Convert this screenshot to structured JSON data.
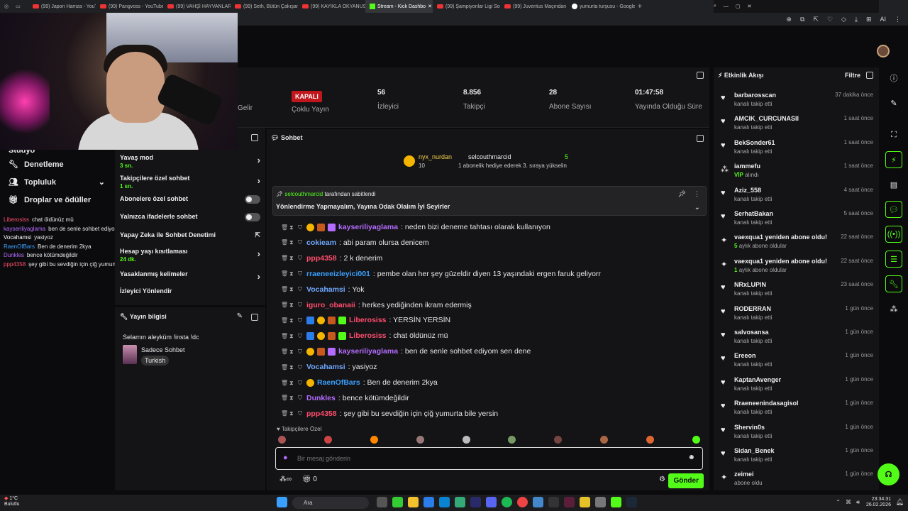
{
  "browser": {
    "tabs": [
      {
        "label": "(99) Japon Hamza - YouTu",
        "icon": "youtube-icon"
      },
      {
        "label": "(99) Pangvoss - YouTube",
        "icon": "youtube-icon"
      },
      {
        "label": "(99) VAHŞİ HAYVANLARI...",
        "icon": "youtube-icon"
      },
      {
        "label": "(99) Seth, Bütün Çakışanla",
        "icon": "youtube-icon"
      },
      {
        "label": "(99) KAYIKLA OKYANUSU",
        "icon": "youtube-icon"
      },
      {
        "label": "Stream - Kick Dashbo",
        "icon": "kick-icon",
        "active": true
      },
      {
        "label": "(99) Şampiyonlar Ligi Son",
        "icon": "youtube-icon"
      },
      {
        "label": "(99) Juventus Maçından Ç",
        "icon": "youtube-icon"
      },
      {
        "label": "yumurta turşusu - Google",
        "icon": "google-icon"
      }
    ],
    "ai_label": "AI"
  },
  "stats": {
    "items": [
      {
        "value": "",
        "label": "Gelir"
      },
      {
        "value": "KAPALI",
        "label": "Çoklu Yayın"
      },
      {
        "value": "56",
        "label": "İzleyici"
      },
      {
        "value": "8.856",
        "label": "Takipçi"
      },
      {
        "value": "28",
        "label": "Abone Sayısı"
      },
      {
        "value": "01:47:58",
        "label": "Yayında Olduğu Süre"
      }
    ]
  },
  "left_nav": {
    "items": [
      {
        "label": "Stüdyo"
      },
      {
        "label": "Denetleme"
      },
      {
        "label": "Topluluk"
      },
      {
        "label": "Droplar ve ödüller"
      }
    ]
  },
  "mini_chat": [
    {
      "user": "Liberosiss",
      "text": "chat öldünüz mü",
      "color": "#ff4d6d"
    },
    {
      "user": "kayseriliyaglama",
      "text": "ben de senle sohbet ediyom sen dene",
      "color": "#b46cff"
    },
    {
      "user": "Vocahamsi",
      "text": "yasiyoz",
      "color": "#ffffff"
    },
    {
      "user": "RaenOfBars",
      "text": "Ben de denerim 2kya",
      "color": "#3aa0ff"
    },
    {
      "user": "Dunkles",
      "text": "bence kötümdeğildir",
      "color": "#b46cff"
    },
    {
      "user": "ppp4358",
      "text": "şey gibi bu sevdiğin için çiğ yumurta bile yersin",
      "color": "#ff4d6d"
    }
  ],
  "mod_settings": {
    "items": [
      {
        "label": "Yavaş mod",
        "sub": "3 sn.",
        "control": "chevron"
      },
      {
        "label": "Takipçilere özel sohbet",
        "sub": "1 sn.",
        "control": "chevron"
      },
      {
        "label": "Abonelere özel sohbet",
        "sub": "",
        "control": "toggle"
      },
      {
        "label": "Yalnızca ifadelerle sohbet",
        "sub": "",
        "control": "toggle"
      },
      {
        "label": "Yapay Zeka ile Sohbet Denetimi",
        "sub": "",
        "control": "external"
      },
      {
        "label": "Hesap yaşı kısıtlaması",
        "sub": "24 dk.",
        "control": "chevron"
      },
      {
        "label": "Yasaklanmış kelimeler",
        "sub": "",
        "control": "chevron"
      },
      {
        "label": "İzleyici Yönlendir",
        "sub": "",
        "control": "none"
      }
    ]
  },
  "stream_info": {
    "title": "Yayın bilgisi",
    "stream_title": "Selamın aleyküm !insta !dc",
    "category": "Sadece Sohbet",
    "language": "Turkish"
  },
  "chat": {
    "title": "Sohbet",
    "gift_event": {
      "gifter": "nyx_nurdan",
      "gifter_count": "10",
      "recipient": "selcouthmarcid",
      "recipient_count": "5",
      "text": "1 abonelik hediye ederek 3. sıraya yükselin"
    },
    "pinned": {
      "by_user": "selcouthmarcid",
      "by_text": "tarafından sabitlendi",
      "message": "Yönlendirme Yapmayalım, Yayına Odak Olalım İyi Seyirler"
    },
    "messages": [
      {
        "user": "kayseriliyaglama",
        "color": "#b46cff",
        "text": ": neden bizi deneme tahtası olarak kullanıyon",
        "badges": [
          "gold",
          "red",
          "purple"
        ]
      },
      {
        "user": "cokieam",
        "color": "#6fa8ff",
        "text": ": abi param olursa denicem",
        "badges": []
      },
      {
        "user": "ppp4358",
        "color": "#ff4d6d",
        "text": ": 2 k denerim",
        "badges": []
      },
      {
        "user": "rraeneeizleyici001",
        "color": "#3aa0ff",
        "text": ": pembe olan her şey güzeldir diyen 13 yaşındaki ergen faruk geliyorr",
        "badges": []
      },
      {
        "user": "Vocahamsi",
        "color": "#6fa8ff",
        "text": ": Yok",
        "badges": []
      },
      {
        "user": "iguro_obanaii",
        "color": "#ff4d6d",
        "text": ": herkes yediğinden ikram edermiş",
        "badges": []
      },
      {
        "user": "Liberosiss",
        "color": "#ff4d6d",
        "text": ": YERSİN YERSİN",
        "badges": [
          "blue",
          "gold",
          "red",
          "green"
        ]
      },
      {
        "user": "Liberosiss",
        "color": "#ff4d6d",
        "text": ": chat öldünüz mü",
        "badges": [
          "blue",
          "gold",
          "red",
          "green"
        ]
      },
      {
        "user": "kayseriliyaglama",
        "color": "#b46cff",
        "text": ": ben de senle sohbet ediyom sen dene",
        "badges": [
          "gold",
          "red",
          "purple"
        ]
      },
      {
        "user": "Vocahamsi",
        "color": "#6fa8ff",
        "text": ": yasiyoz",
        "badges": []
      },
      {
        "user": "RaenOfBars",
        "color": "#3aa0ff",
        "text": ": Ben de denerim 2kya",
        "badges": [
          "gold"
        ]
      },
      {
        "user": "Dunkles",
        "color": "#b46cff",
        "text": ": bence kötümdeğildir",
        "badges": []
      },
      {
        "user": "ppp4358",
        "color": "#ff4d6d",
        "text": ": şey gibi bu sevdiğin için çiğ yumurta bile yersin",
        "badges": []
      }
    ],
    "followers_label": "Takipçilere Özel",
    "input_placeholder": "Bir mesaj gönderin",
    "points_value": "0",
    "send_label": "Gönder"
  },
  "activity": {
    "title": "Etkinlik Akışı",
    "filter_label": "Filtre",
    "events": [
      {
        "name": "barbarosscan",
        "desc": "kanalı takip etti",
        "time": "37 dakika önce",
        "icon": "heart-icon"
      },
      {
        "name": "AMCIK_CURCUNASII",
        "desc": "kanalı takip etti",
        "time": "1 saat önce",
        "icon": "heart-icon"
      },
      {
        "name": "BekSonder61",
        "desc": "kanalı takip etti",
        "time": "1 saat önce",
        "icon": "heart-icon"
      },
      {
        "name": "iammefu",
        "desc": "alındı",
        "highlight": "VİP",
        "time": "1 saat önce",
        "icon": "vip-icon"
      },
      {
        "name": "Aziz_558",
        "desc": "kanalı takip etti",
        "time": "4 saat önce",
        "icon": "heart-icon"
      },
      {
        "name": "SerhatBakan",
        "desc": "kanalı takip etti",
        "time": "5 saat önce",
        "icon": "heart-icon"
      },
      {
        "name": "vaexqua1 yeniden abone oldu!",
        "desc": "aylık abone oldular",
        "highlight": "5",
        "time": "22 saat önce",
        "icon": "sparkle-icon"
      },
      {
        "name": "vaexqua1 yeniden abone oldu!",
        "desc": "aylık abone oldular",
        "highlight": "1",
        "time": "22 saat önce",
        "icon": "sparkle-icon"
      },
      {
        "name": "NRxLUPIN",
        "desc": "kanalı takip etti",
        "time": "23 saat önce",
        "icon": "heart-icon"
      },
      {
        "name": "RODERRAN",
        "desc": "kanalı takip etti",
        "time": "1 gün önce",
        "icon": "heart-icon"
      },
      {
        "name": "salvosansa",
        "desc": "kanalı takip etti",
        "time": "1 gün önce",
        "icon": "heart-icon"
      },
      {
        "name": "Ereeon",
        "desc": "kanalı takip etti",
        "time": "1 gün önce",
        "icon": "heart-icon"
      },
      {
        "name": "KaptanAvenger",
        "desc": "kanalı takip etti",
        "time": "1 gün önce",
        "icon": "heart-icon"
      },
      {
        "name": "Rraeneenindasagisol",
        "desc": "kanalı takip etti",
        "time": "1 gün önce",
        "icon": "heart-icon"
      },
      {
        "name": "Shervin0s",
        "desc": "kanalı takip etti",
        "time": "1 gün önce",
        "icon": "heart-icon"
      },
      {
        "name": "Sidan_Benek",
        "desc": "kanalı takip etti",
        "time": "1 gün önce",
        "icon": "heart-icon"
      },
      {
        "name": "zeimei",
        "desc": "abone oldu",
        "time": "1 gün önce",
        "icon": "sparkle-icon"
      }
    ]
  },
  "taskbar": {
    "weather_temp": "1°C",
    "weather_text": "Bulutlu",
    "search_label": "Ara",
    "time": "23:34:31",
    "date": "26.02.2026"
  },
  "colors": {
    "kick_green": "#53fc18",
    "panel": "#141416",
    "background": "#0b0b0d",
    "offline_red": "#c0171d"
  }
}
